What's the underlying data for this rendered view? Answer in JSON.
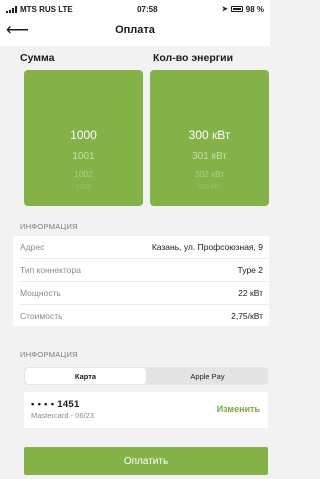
{
  "status_bar": {
    "carrier": "MTS RUS LTE",
    "time": "07:58",
    "battery": "98 %"
  },
  "header": {
    "title": "Оплата"
  },
  "columns": {
    "sum_label": "Сумма",
    "energy_label": "Кол-во энергии"
  },
  "sum_picker": {
    "selected": "1000",
    "below": [
      "1001",
      "1002",
      "1003"
    ]
  },
  "energy_picker": {
    "selected": "300 кВт",
    "below": [
      "301 кВт",
      "302 кВт",
      "303 кВт"
    ]
  },
  "info": {
    "caption": "ИНФОРМАЦИЯ",
    "rows": [
      {
        "label": "Адрес",
        "value": "Казань, ул. Профсоюзная, 9"
      },
      {
        "label": "Тип коннектора",
        "value": "Type 2"
      },
      {
        "label": "Мощность",
        "value": "22 кВт"
      },
      {
        "label": "Стоимость",
        "value": "2,75/кВт"
      }
    ]
  },
  "payment": {
    "caption": "ИНФОРМАЦИЯ",
    "tabs": [
      {
        "label": "Карта",
        "active": true
      },
      {
        "label": "Apple Pay",
        "active": false
      }
    ],
    "card_number": "• • • • 1451",
    "card_details": "Mastercard - 06/23",
    "change_label": "Изменить"
  },
  "pay_button": {
    "label": "Оплатить"
  },
  "colors": {
    "accent": "#84b249",
    "link": "#78a840",
    "background": "#f2f2f2"
  }
}
